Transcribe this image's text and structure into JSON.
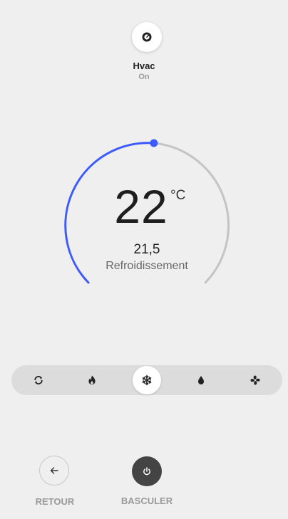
{
  "device": {
    "name": "Hvac",
    "state": "On",
    "icon": "thermostat-icon"
  },
  "thermostat": {
    "target_temperature": "22",
    "unit": "°C",
    "current_temperature": "21,5",
    "hvac_action": "Refroidissement",
    "colors": {
      "active_arc": "#3d5afe",
      "inactive_arc": "#c4c4c4"
    }
  },
  "modes": [
    {
      "name": "auto",
      "icon": "cycle-icon",
      "active": false
    },
    {
      "name": "heat",
      "icon": "flame-icon",
      "active": false
    },
    {
      "name": "cool",
      "icon": "snowflake-icon",
      "active": true
    },
    {
      "name": "dry",
      "icon": "water-drop-icon",
      "active": false
    },
    {
      "name": "fan_only",
      "icon": "fan-icon",
      "active": false
    }
  ],
  "actions": {
    "back_label": "RETOUR",
    "toggle_label": "BASCULER"
  }
}
